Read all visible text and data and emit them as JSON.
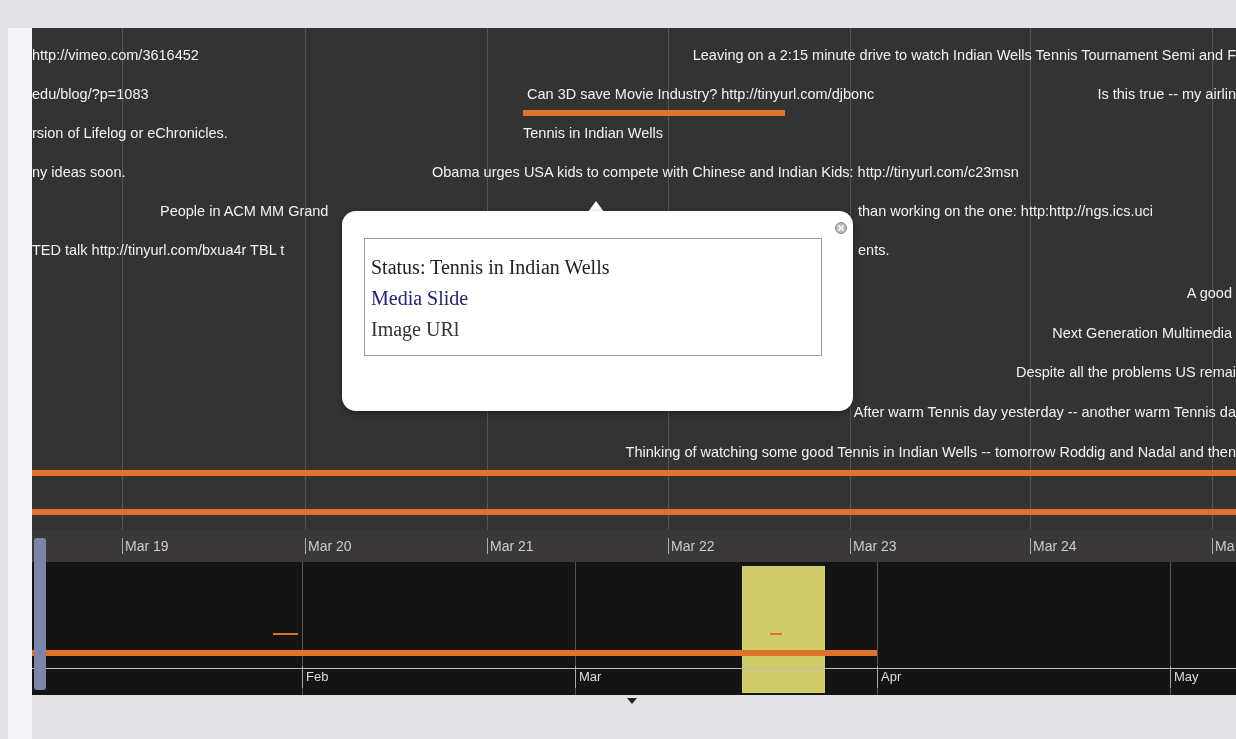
{
  "upper_band": {
    "events": [
      {
        "text": "http://vimeo.com/3616452"
      },
      {
        "text": "Leaving on a 2:15 minute drive to watch Indian Wells Tennis Tournament Semi and F"
      },
      {
        "text": "edu/blog/?p=1083"
      },
      {
        "text": "Can 3D save Movie Industry? http://tinyurl.com/djbonc"
      },
      {
        "text": "Is this true -- my airlin"
      },
      {
        "text": "rsion of Lifelog or eChronicles."
      },
      {
        "text": "Tennis in Indian Wells"
      },
      {
        "text": "ny ideas soon."
      },
      {
        "text": "Obama urges USA kids to compete with Chinese and Indian Kids: http://tinyurl.com/c23msn"
      },
      {
        "text": "People in ACM MM Grand"
      },
      {
        "text": "than working on the one: http:http://ngs.ics.uci"
      },
      {
        "text": "TED talk http://tinyurl.com/bxua4r TBL t"
      },
      {
        "text": "ents."
      },
      {
        "text": "A good"
      },
      {
        "text": "Next Generation Multimedia"
      },
      {
        "text": "Despite all the problems US remai"
      },
      {
        "text": "After warm Tennis day yesterday -- another warm Tennis da"
      },
      {
        "text": "Thinking of watching some good Tennis in Indian Wells -- tomorrow Roddig and Nadal and then"
      }
    ],
    "dates": [
      "Mar 19",
      "Mar 20",
      "Mar 21",
      "Mar 22",
      "Mar 23",
      "Mar 24",
      "Ma"
    ]
  },
  "lower_band": {
    "months": [
      "Feb",
      "Mar",
      "Apr",
      "May"
    ]
  },
  "popup": {
    "status": "Status: Tennis in Indian Wells",
    "link": "Media Slide",
    "image": "Image URl"
  }
}
